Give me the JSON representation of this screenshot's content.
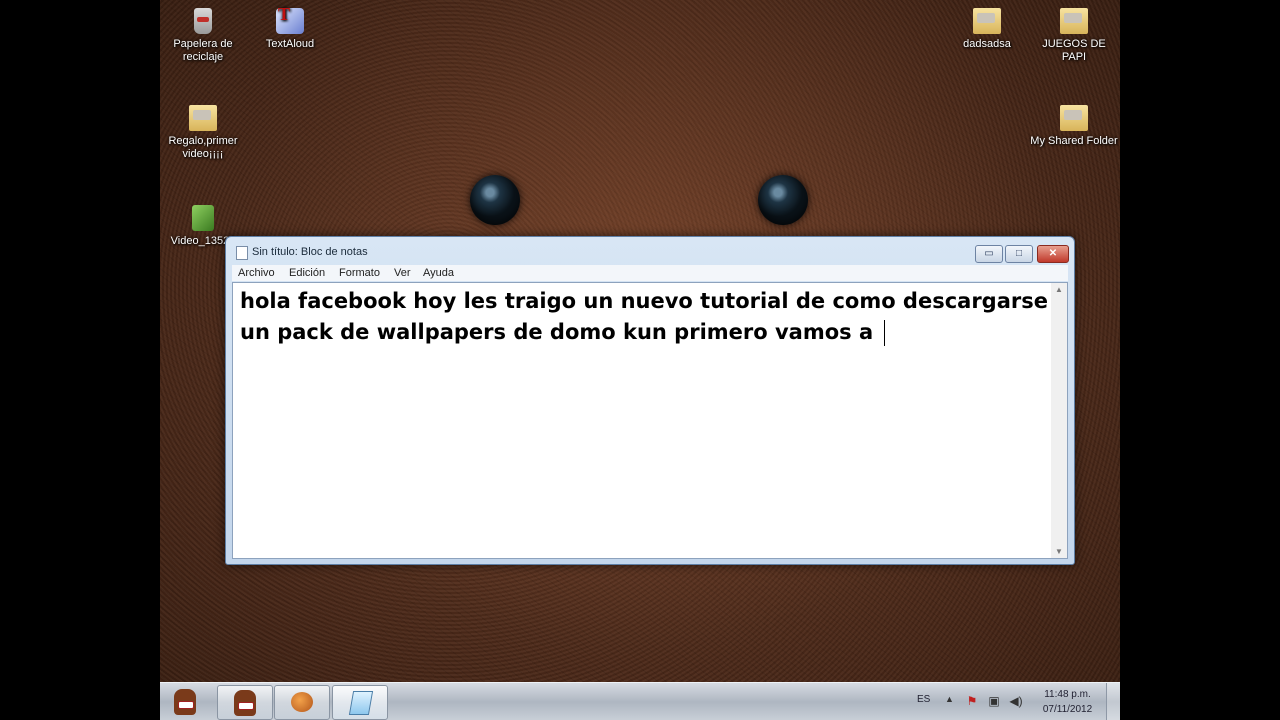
{
  "desktop": {
    "icons": [
      {
        "label": "Papelera de reciclaje",
        "icon": "recycle-bin-icon"
      },
      {
        "label": "TextAloud",
        "icon": "text-to-speech-icon"
      },
      {
        "label": "Regalo,primer video¡¡¡¡",
        "icon": "folder-icon"
      },
      {
        "label": "Video_13523",
        "icon": "video-file-icon"
      },
      {
        "label": "dadsadsa",
        "icon": "folder-icon"
      },
      {
        "label": "JUEGOS DE PAPI",
        "icon": "folder-icon"
      },
      {
        "label": "My Shared Folder",
        "icon": "folder-icon"
      }
    ]
  },
  "window": {
    "title": "Sin título: Bloc de notas",
    "menu": [
      "Archivo",
      "Edición",
      "Formato",
      "Ver",
      "Ayuda"
    ],
    "content": "hola facebook hoy les traigo un nuevo tutorial de como descargarse un pack de wallpapers de domo kun primero vamos a ",
    "buttons": {
      "minimize": "▭",
      "maximize": "□",
      "close": "✕"
    }
  },
  "taskbar": {
    "language": "ES",
    "time": "11:48 p.m.",
    "date": "07/11/2012",
    "tray_arrow": "▲"
  },
  "colors": {
    "accent": "#c0392b",
    "wallpaper": "#5a3320"
  }
}
